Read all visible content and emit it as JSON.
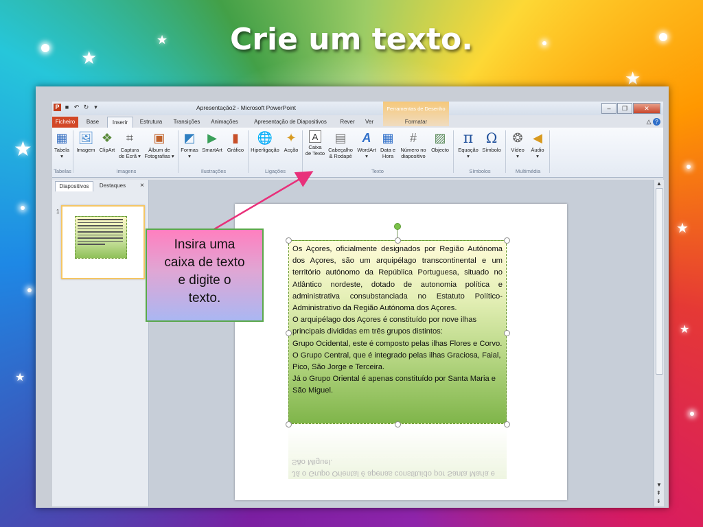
{
  "slide_title": "Crie um texto.",
  "window": {
    "title": "Apresentação2 - Microsoft PowerPoint",
    "context_tab_group": "Ferramentas de Desenho"
  },
  "tabs": [
    "Ficheiro",
    "Base",
    "Inserir",
    "Estrutura",
    "Transições",
    "Animações",
    "Apresentação de Diapositivos",
    "Rever",
    "Ver",
    "Formatar"
  ],
  "active_tab": "Inserir",
  "ribbon": {
    "buttons": [
      {
        "label1": "Tabela",
        "label2": "",
        "icon": "table-icon"
      },
      {
        "label1": "Imagem",
        "label2": "",
        "icon": "picture-icon"
      },
      {
        "label1": "ClipArt",
        "label2": "",
        "icon": "clipart-icon"
      },
      {
        "label1": "Captura",
        "label2": "de Ecrã ▾",
        "icon": "screenshot-icon"
      },
      {
        "label1": "Álbum de",
        "label2": "Fotografias ▾",
        "icon": "photo-album-icon"
      },
      {
        "label1": "Formas",
        "label2": "",
        "icon": "shapes-icon"
      },
      {
        "label1": "SmartArt",
        "label2": "",
        "icon": "smartart-icon"
      },
      {
        "label1": "Gráfico",
        "label2": "",
        "icon": "chart-icon"
      },
      {
        "label1": "Hiperligação",
        "label2": "",
        "icon": "hyperlink-icon"
      },
      {
        "label1": "Acção",
        "label2": "",
        "icon": "action-icon"
      },
      {
        "label1": "Caixa",
        "label2": "de Texto",
        "icon": "textbox-icon"
      },
      {
        "label1": "Cabeçalho",
        "label2": "& Rodapé",
        "icon": "header-footer-icon"
      },
      {
        "label1": "WordArt",
        "label2": "",
        "icon": "wordart-icon"
      },
      {
        "label1": "Data e",
        "label2": "Hora",
        "icon": "date-time-icon"
      },
      {
        "label1": "Número no",
        "label2": "diapositivo",
        "icon": "slide-number-icon"
      },
      {
        "label1": "Objecto",
        "label2": "",
        "icon": "object-icon"
      },
      {
        "label1": "Equação",
        "label2": "",
        "icon": "equation-icon"
      },
      {
        "label1": "Símbolo",
        "label2": "",
        "icon": "symbol-icon"
      },
      {
        "label1": "Vídeo",
        "label2": "",
        "icon": "video-icon"
      },
      {
        "label1": "Áudio",
        "label2": "",
        "icon": "audio-icon"
      }
    ],
    "groups": [
      "Tabelas",
      "Imagens",
      "Ilustrações",
      "Ligações",
      "Texto",
      "Símbolos",
      "Multimédia"
    ]
  },
  "panel": {
    "tabs": [
      "Diapositivos",
      "Destaques"
    ],
    "close": "×",
    "slide_number": "1"
  },
  "textbox": {
    "paragraphs": [
      "Os Açores, oficialmente designados por Região Autónoma dos Açores, são um arquipélago transcontinental e um território autónomo da República Portuguesa, situado no Atlântico nordeste, dotado de autonomia política e administrativa consubstanciada no Estatuto Político-Administrativo da Região Autónoma dos Açores.",
      "O arquipélago dos Açores é constituído por nove ilhas principais divididas em três grupos distintos:",
      "Grupo Ocidental, este é composto pelas ilhas Flores e Corvo.",
      "O Grupo Central, que é integrado pelas ilhas Graciosa, Faial, Pico, São Jorge e Terceira.",
      "Já o Grupo Oriental é apenas constituído por Santa Maria e São Miguel."
    ],
    "reflection": [
      "São Miguel.",
      "Já o Grupo Oriental é apenas constituído por Santa Maria e"
    ]
  },
  "callout": {
    "line1": "Insira uma",
    "line2": "caixa de texto",
    "line3": "e digite o",
    "line4": "texto."
  },
  "colors": {
    "callout_border": "#5aa84a",
    "arrow": "#e8307a",
    "textbox_fill": "#b9d886"
  }
}
